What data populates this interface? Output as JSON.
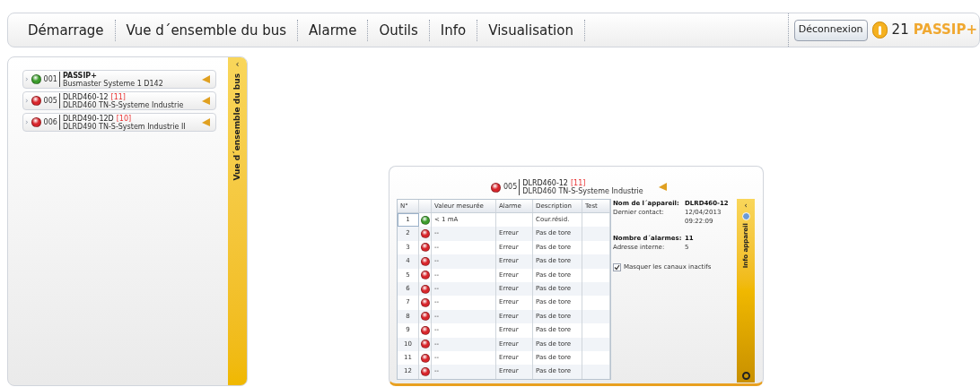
{
  "nav": {
    "items": [
      {
        "label": "Démarrage"
      },
      {
        "label": "Vue d´ensemble du bus"
      },
      {
        "label": "Alarme"
      },
      {
        "label": "Outils"
      },
      {
        "label": "Info"
      },
      {
        "label": "Visualisation"
      }
    ],
    "logout": "Déconnexion",
    "alarm_count": "21",
    "brand": "PASSIP+"
  },
  "bus_panel": {
    "tab_label": "Vue d´ensemble du bus",
    "collapse": "‹",
    "devices": [
      {
        "expand": "›",
        "address": "001",
        "color": "#3c9c2c",
        "name": "PASSIP+",
        "subtitle": "Busmaster Systeme 1 D142",
        "name_bold": true
      },
      {
        "expand": "›",
        "address": "005",
        "color": "#d8262c",
        "name": "DLRD460-12",
        "count": "[11]",
        "subtitle": "DLRD460 TN-S-Systeme Industrie",
        "name_bold": false
      },
      {
        "expand": "›",
        "address": "006",
        "color": "#d8262c",
        "name": "DLRD490-12D",
        "count": "[10]",
        "subtitle": "DLRD490 TN-S-System Industrie II",
        "name_bold": false
      }
    ]
  },
  "device_window": {
    "address": "005",
    "color": "#d8262c",
    "name": "DLRD460-12",
    "count": "[11]",
    "subtitle": "DLRD460 TN-S-Systeme Industrie",
    "table": {
      "columns": [
        "N°",
        "Valeur mesurée",
        "Alarme",
        "Description",
        "Test"
      ],
      "rows": [
        {
          "n": "1",
          "color": "#3c9c2c",
          "value": "< 1 mA",
          "alarm": "",
          "description": "Cour.résid.",
          "selected": true
        },
        {
          "n": "2",
          "color": "#d8262c",
          "value": "--",
          "alarm": "Erreur",
          "description": "Pas de tore",
          "selected": false
        },
        {
          "n": "3",
          "color": "#d8262c",
          "value": "--",
          "alarm": "Erreur",
          "description": "Pas de tore",
          "selected": false
        },
        {
          "n": "4",
          "color": "#d8262c",
          "value": "--",
          "alarm": "Erreur",
          "description": "Pas de tore",
          "selected": false
        },
        {
          "n": "5",
          "color": "#d8262c",
          "value": "--",
          "alarm": "Erreur",
          "description": "Pas de tore",
          "selected": false
        },
        {
          "n": "6",
          "color": "#d8262c",
          "value": "--",
          "alarm": "Erreur",
          "description": "Pas de tore",
          "selected": false
        },
        {
          "n": "7",
          "color": "#d8262c",
          "value": "--",
          "alarm": "Erreur",
          "description": "Pas de tore",
          "selected": false
        },
        {
          "n": "8",
          "color": "#d8262c",
          "value": "--",
          "alarm": "Erreur",
          "description": "Pas de tore",
          "selected": false
        },
        {
          "n": "9",
          "color": "#d8262c",
          "value": "--",
          "alarm": "Erreur",
          "description": "Pas de tore",
          "selected": false
        },
        {
          "n": "10",
          "color": "#d8262c",
          "value": "--",
          "alarm": "Erreur",
          "description": "Pas de tore",
          "selected": false
        },
        {
          "n": "11",
          "color": "#d8262c",
          "value": "--",
          "alarm": "Erreur",
          "description": "Pas de tore",
          "selected": false
        },
        {
          "n": "12",
          "color": "#d8262c",
          "value": "--",
          "alarm": "Erreur",
          "description": "Pas de tore",
          "selected": false
        }
      ]
    },
    "info": {
      "fields": [
        {
          "label": "Nom de l´appareil:",
          "value": "DLRD460-12",
          "bold": true
        },
        {
          "label": "Dernier contact:",
          "value": "12/04/2013 09:22:09",
          "bold": false
        },
        {
          "label": "Nombre d´alarmes:",
          "value": "11",
          "bold": true
        },
        {
          "label": "Adresse interne:",
          "value": "5",
          "bold": false
        }
      ],
      "hide_inactive": {
        "label": "Masquer les canaux inactifs",
        "checked": true
      },
      "tab_label": "Info appareil",
      "collapse": "‹"
    }
  }
}
